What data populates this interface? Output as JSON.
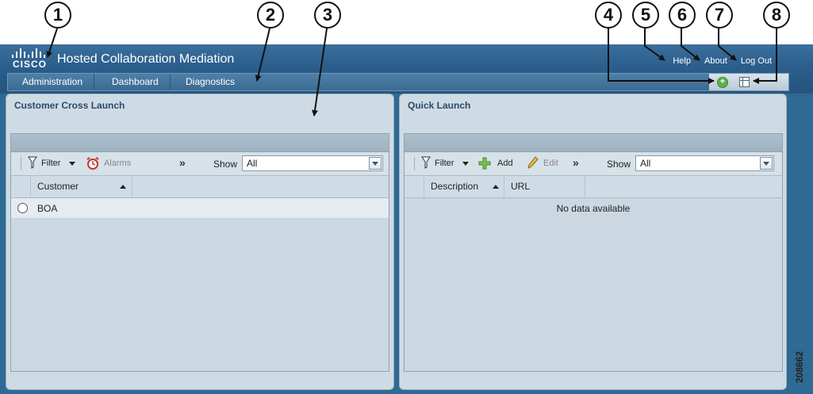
{
  "callouts": [
    "1",
    "2",
    "3",
    "4",
    "5",
    "6",
    "7",
    "8"
  ],
  "header": {
    "logo_text": "CISCO",
    "title": "Hosted Collaboration Mediation",
    "links": {
      "help": "Help",
      "about": "About",
      "logout": "Log Out"
    },
    "icons": {
      "add": "add-portlet-icon",
      "layout": "layout-icon"
    }
  },
  "nav": {
    "items": [
      "Administration",
      "Dashboard",
      "Diagnostics"
    ]
  },
  "panels": {
    "customer": {
      "title": "Customer Cross Launch",
      "toolbar": {
        "filter": "Filter",
        "alarms": "Alarms",
        "more": "»",
        "show_label": "Show",
        "show_value": "All"
      },
      "columns": [
        "Customer"
      ],
      "rows": [
        {
          "customer": "BOA"
        }
      ]
    },
    "quick": {
      "title": "Quick Launch",
      "toolbar": {
        "filter": "Filter",
        "add": "Add",
        "edit": "Edit",
        "more": "»",
        "show_label": "Show",
        "show_value": "All"
      },
      "columns": [
        "Description",
        "URL"
      ],
      "empty_text": "No data available"
    }
  },
  "figure_id": "208662",
  "colors": {
    "header": "#2b5e8c",
    "panel": "#cfdbe4",
    "accent": "#2a4a6a"
  }
}
